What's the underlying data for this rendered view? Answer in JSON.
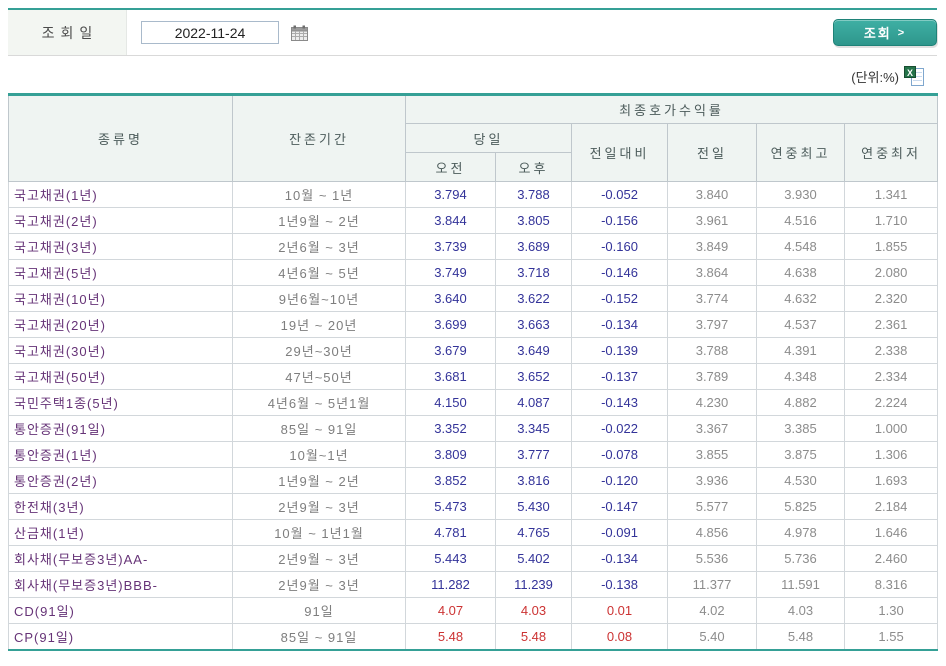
{
  "colors": {
    "accent_teal": "#35A096",
    "value_navy": "#333399",
    "value_red": "#CC3333",
    "name_purple": "#663377",
    "reference_gray": "#8C8C8C",
    "header_bg": "#EFF4F2"
  },
  "form": {
    "date_label": "조회일",
    "date_value": "2022-11-24",
    "search_label": "조회",
    "search_arrow": ">"
  },
  "unit_label": "(단위:%)",
  "icons": {
    "calendar": "calendar-icon",
    "excel": "excel-download-icon",
    "excel_glyph": "X"
  },
  "table": {
    "headers": {
      "type": "종류명",
      "period": "잔존기간",
      "yield_group": "최종호가수익률",
      "today": "당일",
      "am": "오전",
      "pm": "오후",
      "diff": "전일대비",
      "prev": "전일",
      "year_high": "연중최고",
      "year_low": "연중최저"
    },
    "rows": [
      {
        "name": "국고채권(1년)",
        "period": "10월 ~ 1년",
        "am": "3.794",
        "pm": "3.788",
        "diff": "-0.052",
        "prev": "3.840",
        "high": "3.930",
        "low": "1.341",
        "tone": "minus"
      },
      {
        "name": "국고채권(2년)",
        "period": "1년9월 ~ 2년",
        "am": "3.844",
        "pm": "3.805",
        "diff": "-0.156",
        "prev": "3.961",
        "high": "4.516",
        "low": "1.710",
        "tone": "minus"
      },
      {
        "name": "국고채권(3년)",
        "period": "2년6월 ~ 3년",
        "am": "3.739",
        "pm": "3.689",
        "diff": "-0.160",
        "prev": "3.849",
        "high": "4.548",
        "low": "1.855",
        "tone": "minus"
      },
      {
        "name": "국고채권(5년)",
        "period": "4년6월 ~ 5년",
        "am": "3.749",
        "pm": "3.718",
        "diff": "-0.146",
        "prev": "3.864",
        "high": "4.638",
        "low": "2.080",
        "tone": "minus"
      },
      {
        "name": "국고채권(10년)",
        "period": "9년6월~10년",
        "am": "3.640",
        "pm": "3.622",
        "diff": "-0.152",
        "prev": "3.774",
        "high": "4.632",
        "low": "2.320",
        "tone": "minus"
      },
      {
        "name": "국고채권(20년)",
        "period": "19년 ~ 20년",
        "am": "3.699",
        "pm": "3.663",
        "diff": "-0.134",
        "prev": "3.797",
        "high": "4.537",
        "low": "2.361",
        "tone": "minus"
      },
      {
        "name": "국고채권(30년)",
        "period": "29년~30년",
        "am": "3.679",
        "pm": "3.649",
        "diff": "-0.139",
        "prev": "3.788",
        "high": "4.391",
        "low": "2.338",
        "tone": "minus"
      },
      {
        "name": "국고채권(50년)",
        "period": "47년~50년",
        "am": "3.681",
        "pm": "3.652",
        "diff": "-0.137",
        "prev": "3.789",
        "high": "4.348",
        "low": "2.334",
        "tone": "minus"
      },
      {
        "name": "국민주택1종(5년)",
        "period": "4년6월 ~ 5년1월",
        "am": "4.150",
        "pm": "4.087",
        "diff": "-0.143",
        "prev": "4.230",
        "high": "4.882",
        "low": "2.224",
        "tone": "minus"
      },
      {
        "name": "통안증권(91일)",
        "period": "85일 ~ 91일",
        "am": "3.352",
        "pm": "3.345",
        "diff": "-0.022",
        "prev": "3.367",
        "high": "3.385",
        "low": "1.000",
        "tone": "minus"
      },
      {
        "name": "통안증권(1년)",
        "period": "10월~1년",
        "am": "3.809",
        "pm": "3.777",
        "diff": "-0.078",
        "prev": "3.855",
        "high": "3.875",
        "low": "1.306",
        "tone": "minus"
      },
      {
        "name": "통안증권(2년)",
        "period": "1년9월 ~ 2년",
        "am": "3.852",
        "pm": "3.816",
        "diff": "-0.120",
        "prev": "3.936",
        "high": "4.530",
        "low": "1.693",
        "tone": "minus"
      },
      {
        "name": "한전채(3년)",
        "period": "2년9월 ~ 3년",
        "am": "5.473",
        "pm": "5.430",
        "diff": "-0.147",
        "prev": "5.577",
        "high": "5.825",
        "low": "2.184",
        "tone": "minus"
      },
      {
        "name": "산금채(1년)",
        "period": "10월 ~ 1년1월",
        "am": "4.781",
        "pm": "4.765",
        "diff": "-0.091",
        "prev": "4.856",
        "high": "4.978",
        "low": "1.646",
        "tone": "minus"
      },
      {
        "name": "회사채(무보증3년)AA-",
        "period": "2년9월 ~ 3년",
        "am": "5.443",
        "pm": "5.402",
        "diff": "-0.134",
        "prev": "5.536",
        "high": "5.736",
        "low": "2.460",
        "tone": "minus"
      },
      {
        "name": "회사채(무보증3년)BBB-",
        "period": "2년9월 ~ 3년",
        "am": "11.282",
        "pm": "11.239",
        "diff": "-0.138",
        "prev": "11.377",
        "high": "11.591",
        "low": "8.316",
        "tone": "minus"
      },
      {
        "name": "CD(91일)",
        "period": "91일",
        "am": "4.07",
        "pm": "4.03",
        "diff": "0.01",
        "prev": "4.02",
        "high": "4.03",
        "low": "1.30",
        "tone": "plus"
      },
      {
        "name": "CP(91일)",
        "period": "85일 ~ 91일",
        "am": "5.48",
        "pm": "5.48",
        "diff": "0.08",
        "prev": "5.40",
        "high": "5.48",
        "low": "1.55",
        "tone": "plus"
      }
    ]
  }
}
